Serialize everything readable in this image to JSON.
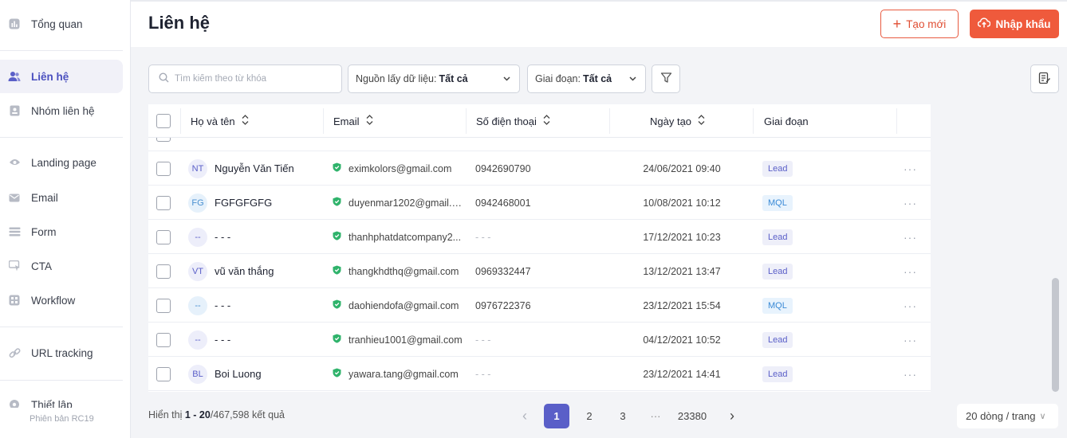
{
  "sidebar": {
    "items": [
      {
        "label": "Tổng quan",
        "icon": "chart-icon"
      },
      {
        "label": "Liên hệ",
        "icon": "contacts-icon",
        "active": true
      },
      {
        "label": "Nhóm liên hệ",
        "icon": "contact-group-icon"
      },
      {
        "label": "Landing page",
        "icon": "landing-page-icon"
      },
      {
        "label": "Email",
        "icon": "mail-icon"
      },
      {
        "label": "Form",
        "icon": "form-icon"
      },
      {
        "label": "CTA",
        "icon": "cta-icon"
      },
      {
        "label": "Workflow",
        "icon": "workflow-icon"
      },
      {
        "label": "URL tracking",
        "icon": "link-icon"
      },
      {
        "label": "Thiết lập",
        "icon": "settings-icon"
      }
    ],
    "version": "Phiên bản RC19"
  },
  "header": {
    "title": "Liên hệ",
    "new_label": "Tạo mới",
    "import_label": "Nhập khẩu"
  },
  "toolbar": {
    "search_placeholder": "Tìm kiếm theo từ khóa",
    "source_label": "Nguồn lấy dữ liệu:",
    "source_value": "Tất cả",
    "stage_label": "Giai đoạn:",
    "stage_value": "Tất cả"
  },
  "table": {
    "columns": {
      "name": "Họ và tên",
      "email": "Email",
      "phone": "Số điện thoại",
      "created": "Ngày tạo",
      "stage": "Giai đoạn"
    },
    "rows": [
      {
        "initials": "NT",
        "name": "Nguyễn Văn Tiến",
        "email": "eximkolors@gmail.com",
        "phone": "0942690790",
        "created": "24/06/2021 09:40",
        "stage": "Lead"
      },
      {
        "initials": "FG",
        "name": "FGFGFGFG",
        "email": "duyenmar1202@gmail.c...",
        "phone": "0942468001",
        "created": "10/08/2021 10:12",
        "stage": "MQL"
      },
      {
        "initials": "--",
        "name": "- - -",
        "email": "thanhphatdatcompany2...",
        "phone": "- - -",
        "created": "17/12/2021 10:23",
        "stage": "Lead"
      },
      {
        "initials": "VT",
        "name": "vũ văn thắng",
        "email": "thangkhdthq@gmail.com",
        "phone": "0969332447",
        "created": "13/12/2021 13:47",
        "stage": "Lead"
      },
      {
        "initials": "--",
        "name": "- - -",
        "email": "daohiendofa@gmail.com",
        "phone": "0976722376",
        "created": "23/12/2021 15:54",
        "stage": "MQL"
      },
      {
        "initials": "--",
        "name": "- - -",
        "email": "tranhieu1001@gmail.com",
        "phone": "- - -",
        "created": "04/12/2021 10:52",
        "stage": "Lead"
      },
      {
        "initials": "BL",
        "name": "Boi Luong",
        "email": "yawara.tang@gmail.com",
        "phone": "- - -",
        "created": "23/12/2021 14:41",
        "stage": "Lead"
      }
    ],
    "more_label": "···"
  },
  "footer": {
    "showing_prefix": "Hiển thị",
    "range": "1 - 20",
    "total": "/467,598 kết quả",
    "pages": [
      "1",
      "2",
      "3",
      "···",
      "23380"
    ],
    "prev": "‹",
    "next": "›",
    "page_size": "20 dòng / trang",
    "page_size_chevron": "∨"
  },
  "colors": {
    "accent": "#5a5fc8",
    "brand": "#ef5a3c"
  }
}
